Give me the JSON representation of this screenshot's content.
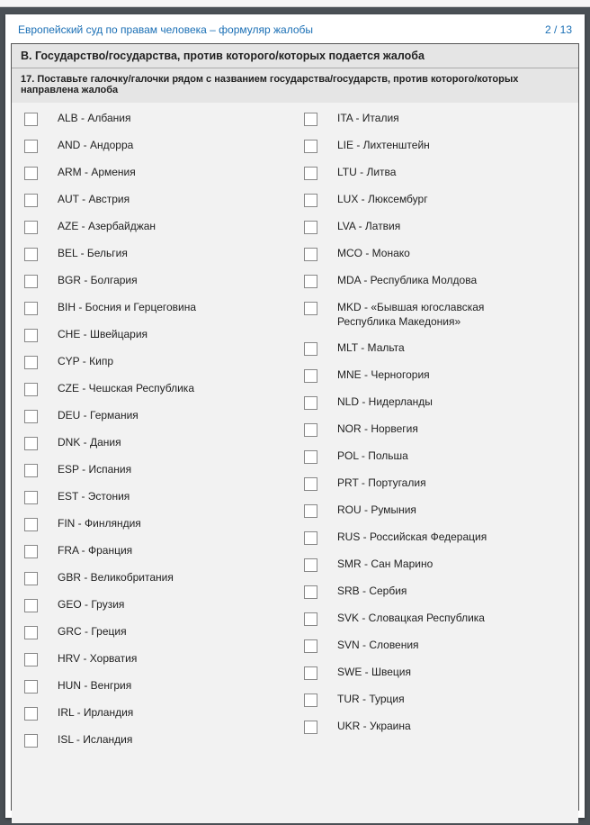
{
  "header": {
    "title": "Европейский суд по правам человека – формуляр жалобы",
    "page_indicator": "2 / 13"
  },
  "section": {
    "title": "B. Государство/государства, против которого/которых подается жалоба",
    "instruction": "17. Поставьте галочку/галочки рядом с названием государства/государств, против которого/которых направлена жалоба"
  },
  "countries_left": [
    {
      "label": "ALB - Албания"
    },
    {
      "label": "AND - Андорра"
    },
    {
      "label": "ARM - Армения"
    },
    {
      "label": "AUT - Австрия"
    },
    {
      "label": "AZE - Азербайджан"
    },
    {
      "label": "BEL - Бельгия"
    },
    {
      "label": "BGR - Болгария"
    },
    {
      "label": "BIH - Босния и Герцеговина"
    },
    {
      "label": "CHE - Швейцария"
    },
    {
      "label": "CYP - Кипр"
    },
    {
      "label": "CZE - Чешская Республика"
    },
    {
      "label": "DEU - Германия"
    },
    {
      "label": "DNK - Дания"
    },
    {
      "label": "ESP - Испания"
    },
    {
      "label": "EST - Эстония"
    },
    {
      "label": "FIN - Финляндия"
    },
    {
      "label": "FRA - Франция"
    },
    {
      "label": "GBR - Великобритания"
    },
    {
      "label": "GEO - Грузия"
    },
    {
      "label": "GRC - Греция"
    },
    {
      "label": "HRV - Хорватия"
    },
    {
      "label": "HUN - Венгрия"
    },
    {
      "label": "IRL - Ирландия"
    },
    {
      "label": "ISL - Исландия"
    }
  ],
  "countries_right": [
    {
      "label": "ITA - Италия"
    },
    {
      "label": "LIE - Лихтенштейн"
    },
    {
      "label": "LTU - Литва"
    },
    {
      "label": "LUX - Люксембург"
    },
    {
      "label": "LVA - Латвия"
    },
    {
      "label": "MCO - Монако"
    },
    {
      "label": "MDA - Республика Молдова"
    },
    {
      "label": "MKD - «Бывшая югославская Республика Македония»",
      "multiline": true
    },
    {
      "label": "MLT - Мальта"
    },
    {
      "label": "MNE - Черногория"
    },
    {
      "label": "NLD - Нидерланды"
    },
    {
      "label": "NOR - Норвегия"
    },
    {
      "label": "POL - Польша"
    },
    {
      "label": "PRT - Португалия"
    },
    {
      "label": "ROU - Румыния"
    },
    {
      "label": "RUS - Российская Федерация"
    },
    {
      "label": "SMR - Сан Марино"
    },
    {
      "label": "SRB - Сербия"
    },
    {
      "label": "SVK - Словацкая Республика"
    },
    {
      "label": "SVN - Словения"
    },
    {
      "label": "SWE - Швеция"
    },
    {
      "label": "TUR - Турция"
    },
    {
      "label": "UKR - Украина"
    }
  ]
}
